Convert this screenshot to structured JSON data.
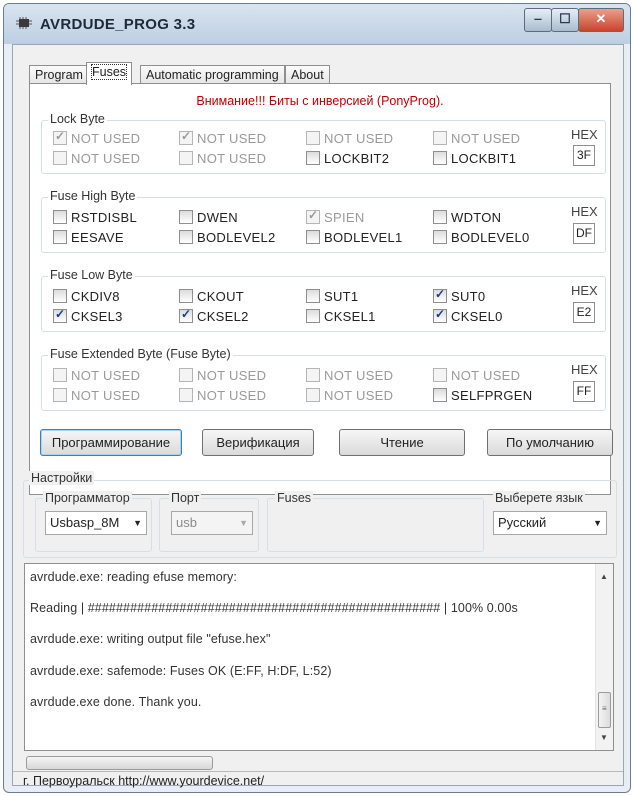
{
  "window": {
    "title": "AVRDUDE_PROG 3.3",
    "minimize": "‒",
    "maximize": "☐",
    "close": "✕"
  },
  "tabs": [
    "Program",
    "Fuses",
    "Automatic programming",
    "About"
  ],
  "warning": "Внимание!!! Биты с инверсией (PonyProg).",
  "hex_label": "HEX",
  "groups": {
    "lock": {
      "title": "Lock Byte",
      "hex": "3F",
      "bits": [
        {
          "label": "NOT USED",
          "checked": true,
          "disabled": true
        },
        {
          "label": "NOT USED",
          "checked": true,
          "disabled": true
        },
        {
          "label": "NOT USED",
          "checked": false,
          "disabled": true
        },
        {
          "label": "NOT USED",
          "checked": false,
          "disabled": true
        },
        {
          "label": "NOT USED",
          "checked": false,
          "disabled": true
        },
        {
          "label": "NOT USED",
          "checked": false,
          "disabled": true
        },
        {
          "label": "LOCKBIT2",
          "checked": false,
          "disabled": false
        },
        {
          "label": "LOCKBIT1",
          "checked": false,
          "disabled": false
        }
      ]
    },
    "high": {
      "title": "Fuse High Byte",
      "hex": "DF",
      "bits": [
        {
          "label": "RSTDISBL",
          "checked": false,
          "disabled": false
        },
        {
          "label": "DWEN",
          "checked": false,
          "disabled": false
        },
        {
          "label": "SPIEN",
          "checked": true,
          "disabled": true
        },
        {
          "label": "WDTON",
          "checked": false,
          "disabled": false
        },
        {
          "label": "EESAVE",
          "checked": false,
          "disabled": false
        },
        {
          "label": "BODLEVEL2",
          "checked": false,
          "disabled": false
        },
        {
          "label": "BODLEVEL1",
          "checked": false,
          "disabled": false
        },
        {
          "label": "BODLEVEL0",
          "checked": false,
          "disabled": false
        }
      ]
    },
    "low": {
      "title": "Fuse Low Byte",
      "hex": "E2",
      "bits": [
        {
          "label": "CKDIV8",
          "checked": false,
          "disabled": false
        },
        {
          "label": "CKOUT",
          "checked": false,
          "disabled": false
        },
        {
          "label": "SUT1",
          "checked": false,
          "disabled": false
        },
        {
          "label": "SUT0",
          "checked": true,
          "disabled": false
        },
        {
          "label": "CKSEL3",
          "checked": true,
          "disabled": false
        },
        {
          "label": "CKSEL2",
          "checked": true,
          "disabled": false
        },
        {
          "label": "CKSEL1",
          "checked": false,
          "disabled": false
        },
        {
          "label": "CKSEL0",
          "checked": true,
          "disabled": false
        }
      ]
    },
    "ext": {
      "title": "Fuse Extended Byte (Fuse Byte)",
      "hex": "FF",
      "bits": [
        {
          "label": "NOT USED",
          "checked": false,
          "disabled": true
        },
        {
          "label": "NOT USED",
          "checked": false,
          "disabled": true
        },
        {
          "label": "NOT USED",
          "checked": false,
          "disabled": true
        },
        {
          "label": "NOT USED",
          "checked": false,
          "disabled": true
        },
        {
          "label": "NOT USED",
          "checked": false,
          "disabled": true
        },
        {
          "label": "NOT USED",
          "checked": false,
          "disabled": true
        },
        {
          "label": "NOT USED",
          "checked": false,
          "disabled": true
        },
        {
          "label": "SELFPRGEN",
          "checked": false,
          "disabled": false
        }
      ]
    }
  },
  "buttons": {
    "program": "Программирование",
    "verify": "Верификация",
    "read": "Чтение",
    "default": "По умолчанию"
  },
  "settings": {
    "title": "Настройки",
    "programmer_label": "Программатор",
    "programmer_value": "Usbasp_8M",
    "port_label": "Порт",
    "port_value": "usb",
    "fuses_label": "Fuses",
    "language_label": "Выберете язык",
    "language_value": "Русский"
  },
  "log": [
    "avrdude.exe: reading efuse memory:",
    "Reading | ################################################## | 100% 0.00s",
    "avrdude.exe: writing output file \"efuse.hex\"",
    "avrdude.exe: safemode: Fuses OK (E:FF, H:DF, L:52)",
    "avrdude.exe done.  Thank you."
  ],
  "status": "г. Первоуральск   http://www.yourdevice.net/"
}
